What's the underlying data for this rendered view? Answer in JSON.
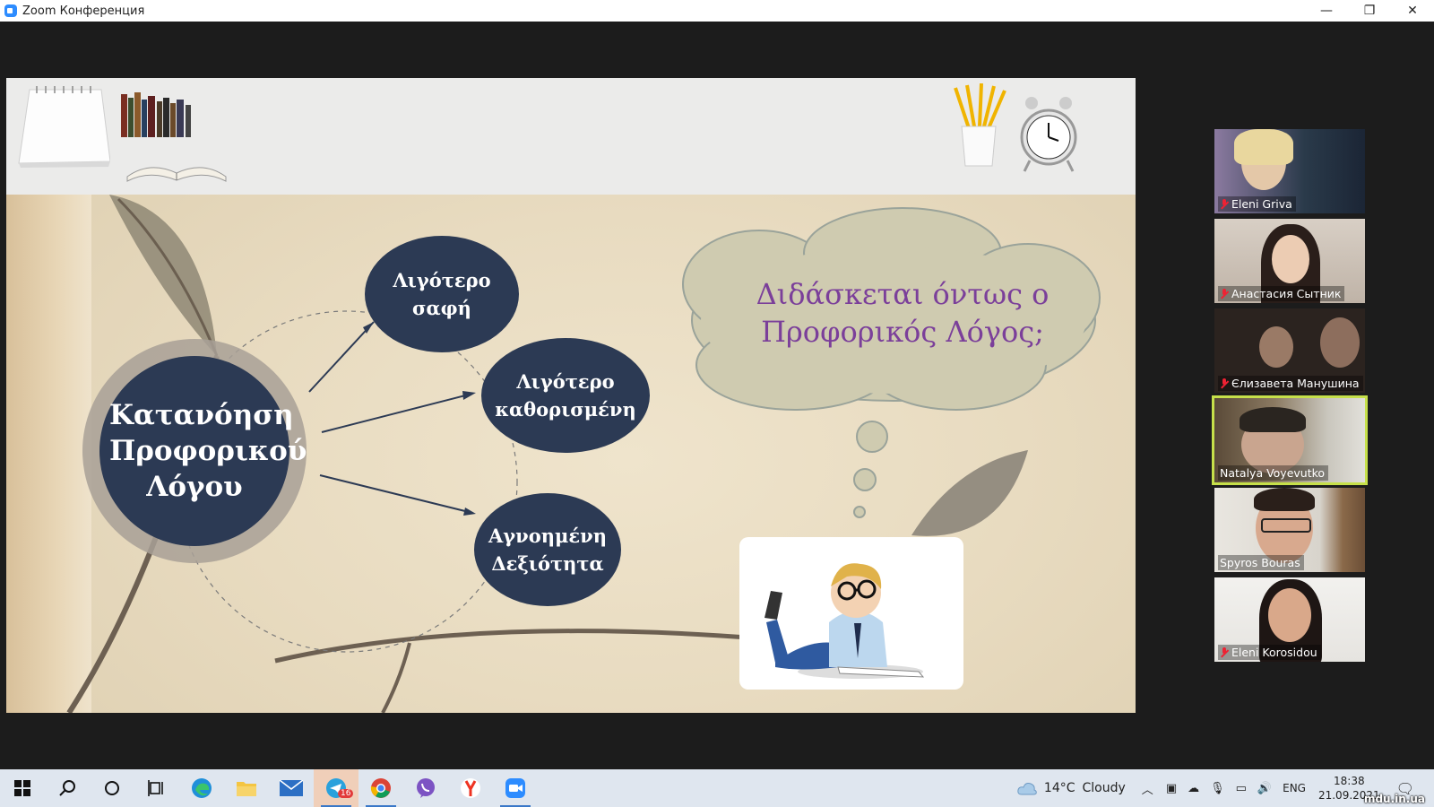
{
  "window": {
    "title": "Zoom Конференция",
    "minimize": "—",
    "restore": "❐",
    "close": "✕"
  },
  "slide": {
    "center_topic": "Κατανόηση Προφορικού Λόγου",
    "bubbles": [
      "Λιγότερο σαφή",
      "Λιγότερο καθορισμένη",
      "Αγνοημένη Δεξιότητα"
    ],
    "cloud_text": "Διδάσκεται όντως ο Προφορικός Λόγος;"
  },
  "participants": [
    {
      "name": "Eleni Griva",
      "muted": true,
      "active": false
    },
    {
      "name": "Анастасия Сытник",
      "muted": true,
      "active": false
    },
    {
      "name": "Єлизавета Манушина",
      "muted": true,
      "active": false
    },
    {
      "name": "Natalya Voyevutko",
      "muted": false,
      "active": true
    },
    {
      "name": "Spyros Bouras",
      "muted": false,
      "active": false
    },
    {
      "name": "Eleni Korosidou",
      "muted": true,
      "active": false
    }
  ],
  "taskbar": {
    "weather_temp": "14°C",
    "weather_cond": "Cloudy",
    "language": "ENG",
    "time": "18:38",
    "date": "21.09.2021",
    "telegram_badge": "16",
    "watermark": "mdu.in.ua"
  }
}
